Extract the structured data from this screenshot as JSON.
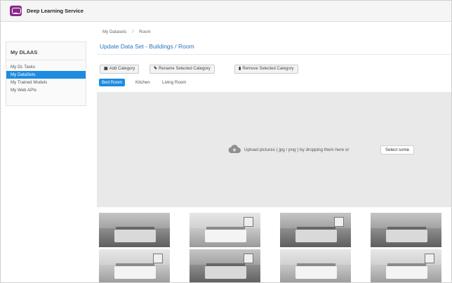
{
  "app": {
    "brand": "Deep Learning Service"
  },
  "sidebar": {
    "title": "My DLAAS",
    "items": [
      {
        "label": "My DL Tasks",
        "active": false
      },
      {
        "label": "My DataSets",
        "active": true
      },
      {
        "label": "My Trained Models",
        "active": false
      },
      {
        "label": "My Web APIs",
        "active": false
      }
    ]
  },
  "breadcrumb": {
    "items": [
      "My Datasets",
      "Room"
    ],
    "separator": "/"
  },
  "page": {
    "title": "Update Data Set - Buildings / Room"
  },
  "toolbar": {
    "add_category": {
      "icon": "plus-square-icon",
      "label": "Add Category"
    },
    "rename_category": {
      "icon": "edit-icon",
      "label": "Rename Selected Category"
    },
    "remove_category": {
      "icon": "trash-icon",
      "label": "Remove Selected Category"
    }
  },
  "tabs": [
    {
      "label": "Bed Room",
      "active": true
    },
    {
      "label": "Kitchen",
      "active": false
    },
    {
      "label": "Living Room",
      "active": false
    }
  ],
  "upload": {
    "icon": "cloud-upload-icon",
    "text": "Upload pictures ( jpg / png ) by dropping them here or",
    "button_label": "Select some"
  },
  "gallery": {
    "images": [
      {
        "subject": "bedroom"
      },
      {
        "subject": "bedroom"
      },
      {
        "subject": "bedroom"
      },
      {
        "subject": "bedroom"
      },
      {
        "subject": "bedroom"
      },
      {
        "subject": "bedroom"
      },
      {
        "subject": "bedroom"
      },
      {
        "subject": "bedroom"
      }
    ]
  },
  "colors": {
    "accent": "#1d8ce0",
    "title": "#2a75b8",
    "brand": "#8a2a8c",
    "dropzone": "#e9e9e9"
  }
}
